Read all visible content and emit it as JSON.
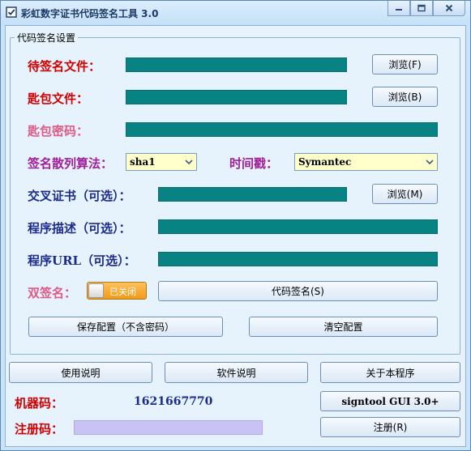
{
  "window": {
    "title": "彩虹数字证书代码签名工具 3.0"
  },
  "group": {
    "label": "代码签名设置"
  },
  "fields": {
    "file_label": "待签名文件：",
    "key_label": "匙包文件：",
    "pwd_label": "匙包密码：",
    "hash_label": "签名散列算法：",
    "hash_value": "sha1",
    "timestamp_label": "时间戳：",
    "timestamp_value": "Symantec",
    "cross_label": "交叉证书（可选）：",
    "desc_label": "程序描述（可选）：",
    "url_label": "程序URL（可选）：",
    "dual_label": "双签名：",
    "dual_state": "已关闭"
  },
  "buttons": {
    "browse_f": "浏览(F)",
    "browse_b": "浏览(B)",
    "browse_m": "浏览(M)",
    "sign": "代码签名(S)",
    "save_config": "保存配置（不含密码）",
    "clear_config": "清空配置",
    "usage": "使用说明",
    "software": "软件说明",
    "about": "关于本程序",
    "signtool": "signtool GUI 3.0+",
    "register": "注册(R)"
  },
  "footer": {
    "machine_label": "机器码：",
    "machine_code": "1621667770",
    "register_label": "注册码："
  },
  "colors": {
    "field_teal": "#078383",
    "label_red": "#d40000",
    "label_pink": "#e05a86",
    "label_purple": "#a0209a",
    "label_navy": "#1c2c8c",
    "toggle_orange": "#f29a16",
    "register_field": "#c9c3f4"
  },
  "icons": {
    "app": "checkbox-icon",
    "minimize": "minimize-icon",
    "maximize": "maximize-icon",
    "close": "close-icon",
    "dropdown": "chevron-down-icon"
  }
}
